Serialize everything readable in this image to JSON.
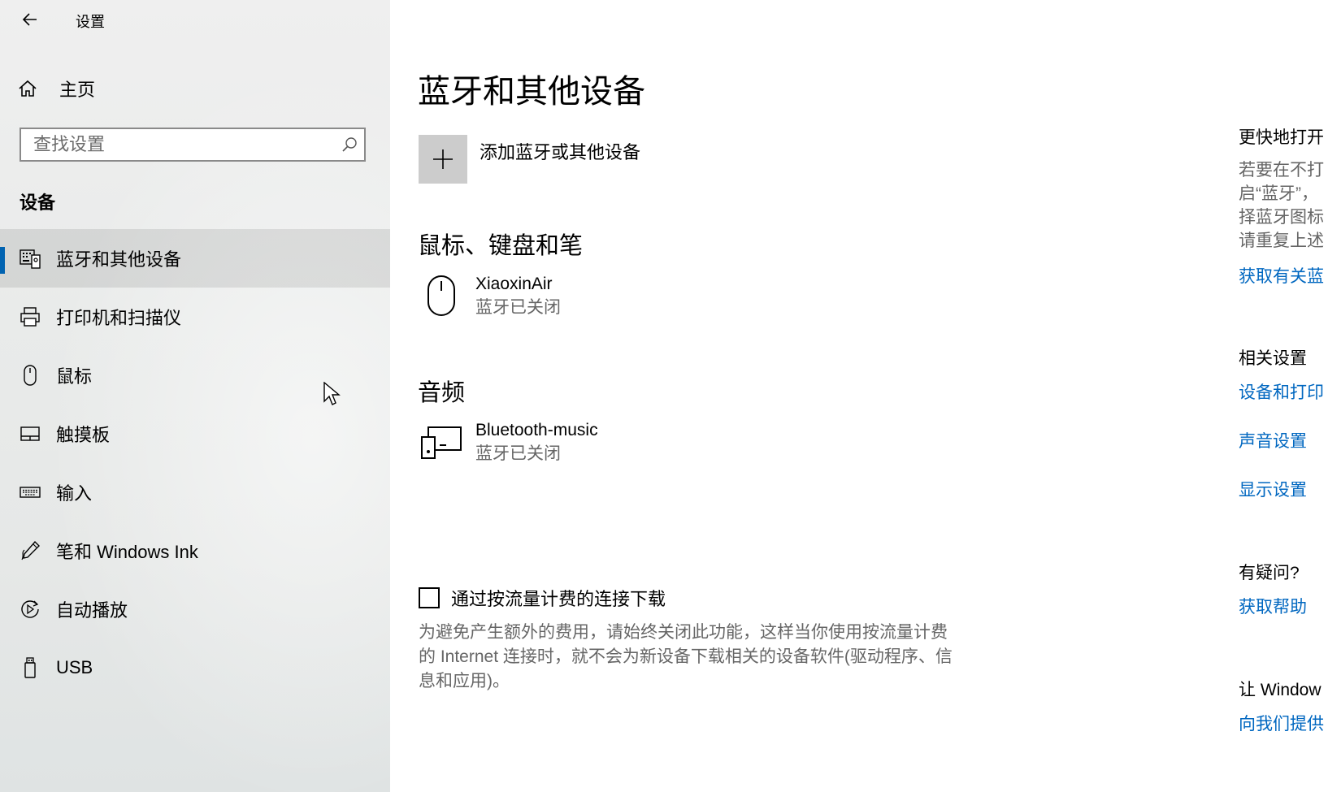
{
  "window": {
    "title": "设置"
  },
  "sidebar": {
    "home_label": "主页",
    "search_placeholder": "查找设置",
    "section_title": "设备",
    "items": [
      {
        "label": "蓝牙和其他设备",
        "icon": "bluetooth-devices-icon",
        "active": true
      },
      {
        "label": "打印机和扫描仪",
        "icon": "printer-icon"
      },
      {
        "label": "鼠标",
        "icon": "mouse-icon"
      },
      {
        "label": "触摸板",
        "icon": "touchpad-icon"
      },
      {
        "label": "输入",
        "icon": "keyboard-icon"
      },
      {
        "label": "笔和 Windows Ink",
        "icon": "pen-icon"
      },
      {
        "label": "自动播放",
        "icon": "autoplay-icon"
      },
      {
        "label": "USB",
        "icon": "usb-icon"
      }
    ]
  },
  "main": {
    "title": "蓝牙和其他设备",
    "add_device_label": "添加蓝牙或其他设备",
    "groups": [
      {
        "title": "鼠标、键盘和笔",
        "devices": [
          {
            "name": "XiaoxinAir",
            "status": "蓝牙已关闭",
            "icon": "mouse-icon"
          }
        ]
      },
      {
        "title": "音频",
        "devices": [
          {
            "name": "Bluetooth-music",
            "status": "蓝牙已关闭",
            "icon": "audio-device-icon"
          }
        ]
      }
    ],
    "metered": {
      "label": "通过按流量计费的连接下载",
      "checked": false,
      "description": "为避免产生额外的费用，请始终关闭此功能，这样当你使用按流量计费的 Internet 连接时，就不会为新设备下载相关的设备软件(驱动程序、信息和应用)。"
    }
  },
  "right_panel": {
    "quick_title": "更快地打开",
    "quick_text_lines": [
      "若要在不打",
      "启“蓝牙”，",
      "择蓝牙图标",
      "请重复上述"
    ],
    "quick_link": "获取有关蓝",
    "related_title": "相关设置",
    "related_links": [
      "设备和打印",
      "声音设置",
      "显示设置"
    ],
    "question_title": "有疑问?",
    "help_link": "获取帮助",
    "improve_title": "让 Window",
    "feedback_link": "向我们提供"
  },
  "colors": {
    "accent": "#0063b1",
    "link": "#0067c0",
    "sidebar_bg": "#ebeceb",
    "secondary_text": "#666666"
  }
}
